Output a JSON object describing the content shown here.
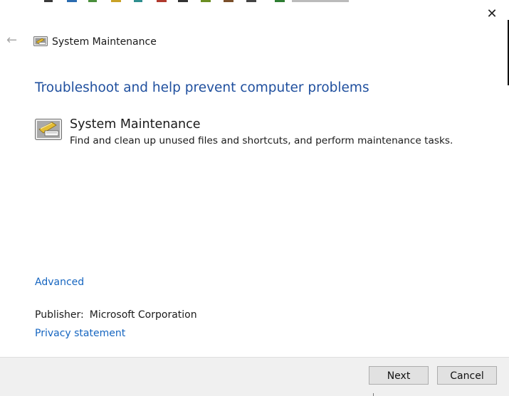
{
  "window": {
    "title": "System Maintenance",
    "close_glyph": "✕",
    "back_glyph": "←"
  },
  "content": {
    "heading": "Troubleshoot and help prevent computer problems",
    "item": {
      "title": "System Maintenance",
      "description": "Find and clean up unused files and shortcuts, and perform maintenance tasks.",
      "icon": "system-maintenance-icon"
    }
  },
  "links": {
    "advanced": "Advanced",
    "privacy": "Privacy statement"
  },
  "publisher": {
    "label": "Publisher:",
    "value": "Microsoft Corporation"
  },
  "buttons": {
    "next": "Next",
    "cancel": "Cancel"
  },
  "colors": {
    "heading": "#1f4f9e",
    "link": "#1565c0",
    "footer_bg": "#f0f0f0",
    "button_bg": "#e1e1e1"
  }
}
